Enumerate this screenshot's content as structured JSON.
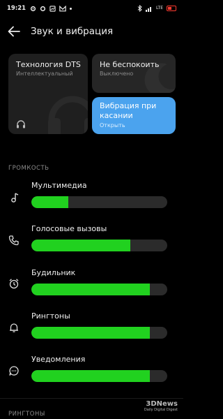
{
  "status_bar": {
    "time": "19:21",
    "left_icons": [
      "settings-icon",
      "bluetooth-icon",
      "image-icon",
      "mail-icon",
      "dot-icon"
    ],
    "right_icons": [
      "bluetooth-icon",
      "signal-icon",
      "lte-icon",
      "battery-low-icon"
    ]
  },
  "header": {
    "title": "Звук и вибрация"
  },
  "cards": {
    "dts": {
      "title": "Технология DTS",
      "subtitle": "Интеллектуальный"
    },
    "dnd": {
      "title": "Не беспокоить",
      "subtitle": "Выключено"
    },
    "vibration": {
      "title_line1": "Вибрация при",
      "title_line2": "касании",
      "subtitle": "Открыть"
    }
  },
  "sections": {
    "volume": "ГРОМКОСТЬ",
    "ringtones": "РИНГТОНЫ"
  },
  "volume_rows": [
    {
      "label": "Мультимедиа",
      "icon": "music-note-icon",
      "level": 0.27
    },
    {
      "label": "Голосовые вызовы",
      "icon": "phone-icon",
      "level": 0.73
    },
    {
      "label": "Будильник",
      "icon": "alarm-icon",
      "level": 0.87
    },
    {
      "label": "Рингтоны",
      "icon": "bell-icon",
      "level": 0.87
    },
    {
      "label": "Уведомления",
      "icon": "chat-bubble-icon",
      "level": 0.87
    }
  ],
  "colors": {
    "accent_blue": "#4ba3ee",
    "slider_fill": "#21d11f",
    "battery": "#ff3b30"
  },
  "watermark": {
    "logo": "3DNews",
    "tagline": "Daily Digital Digest"
  }
}
